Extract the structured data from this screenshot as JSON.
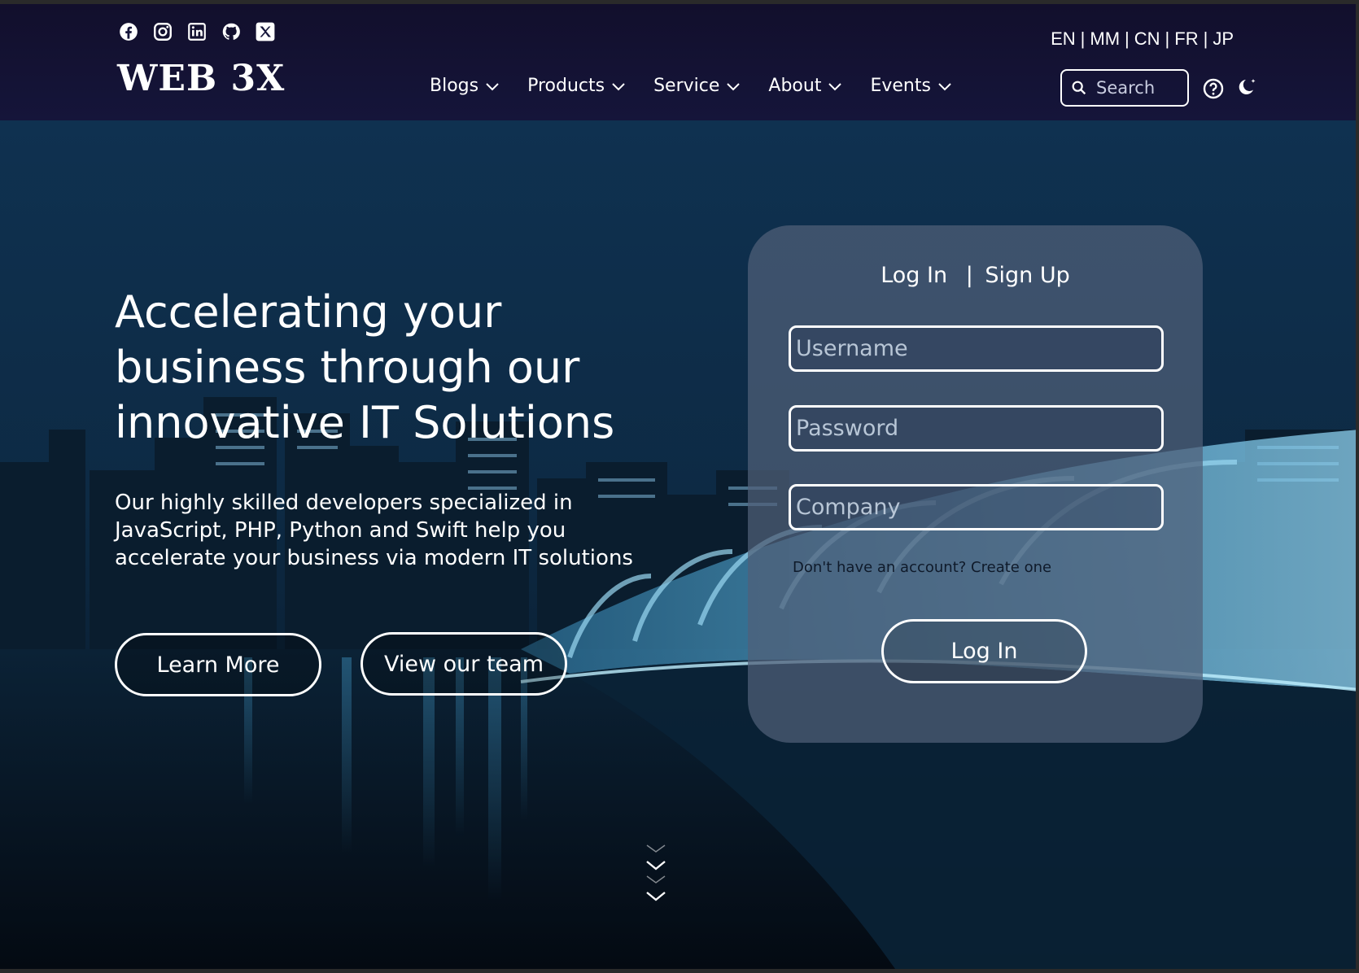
{
  "social": {
    "icons": [
      "facebook-icon",
      "instagram-icon",
      "linkedin-icon",
      "github-icon",
      "x-icon"
    ]
  },
  "brand": {
    "logo": "WEB 3X"
  },
  "languages": [
    "EN",
    "MM",
    "CN",
    "FR",
    "JP"
  ],
  "language_separator": "|",
  "nav": {
    "items": [
      {
        "label": "Blogs"
      },
      {
        "label": "Products"
      },
      {
        "label": "Service"
      },
      {
        "label": "About"
      },
      {
        "label": "Events"
      }
    ]
  },
  "search": {
    "placeholder": "Search"
  },
  "hero": {
    "headline_lines": [
      "Accelerating your",
      "business through our",
      "innovative IT Solutions"
    ],
    "sub_lines": [
      "Our highly skilled developers specialized in",
      "JavaScript, PHP, Python and Swift help you",
      "accelerate your business via modern IT solutions"
    ],
    "learn_more": "Learn More",
    "view_team": "View our team"
  },
  "login": {
    "tab_login": "Log In",
    "tab_separator": "|",
    "tab_signup": "Sign Up",
    "username_placeholder": "Username",
    "password_placeholder": "Password",
    "company_placeholder": "Company",
    "account_link": "Don't have an account? Create one",
    "submit": "Log In"
  },
  "colors": {
    "header_bg": "#120f2c",
    "hero_tint": "#0d2a44",
    "card_bg": "#506078",
    "text": "#ffffff"
  }
}
